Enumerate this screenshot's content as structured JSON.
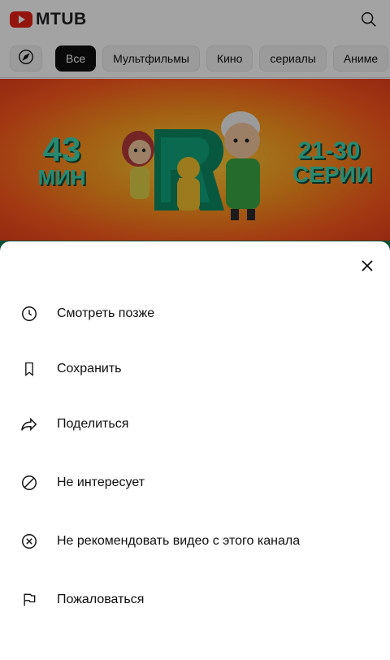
{
  "header": {
    "logo_text": "MTUB",
    "search_icon": "search-icon"
  },
  "chips": {
    "explore_icon": "compass-icon",
    "items": [
      {
        "label": "Все",
        "active": true
      },
      {
        "label": "Мультфильмы",
        "active": false
      },
      {
        "label": "Кино",
        "active": false
      },
      {
        "label": "сериалы",
        "active": false
      },
      {
        "label": "Аниме",
        "active": false
      }
    ]
  },
  "thumbnail": {
    "left_number": "43",
    "left_unit": "МИН",
    "right_range": "21-30",
    "right_unit": "СЕРИИ"
  },
  "sheet": {
    "close_icon": "close-icon",
    "items": [
      {
        "label": "Смотреть позже",
        "icon": "clock-icon"
      },
      {
        "label": "Сохранить",
        "icon": "bookmark-icon"
      },
      {
        "label": "Поделиться",
        "icon": "share-icon"
      },
      {
        "label": "Не интересует",
        "icon": "block-icon"
      },
      {
        "label": "Не рекомендовать видео с этого канала",
        "icon": "circle-x-icon"
      },
      {
        "label": "Пожаловаться",
        "icon": "flag-icon"
      }
    ]
  },
  "colors": {
    "brand": "#e62117",
    "active_chip": "#0f0f0f",
    "scrim": "rgba(0,0,0,0.36)"
  }
}
